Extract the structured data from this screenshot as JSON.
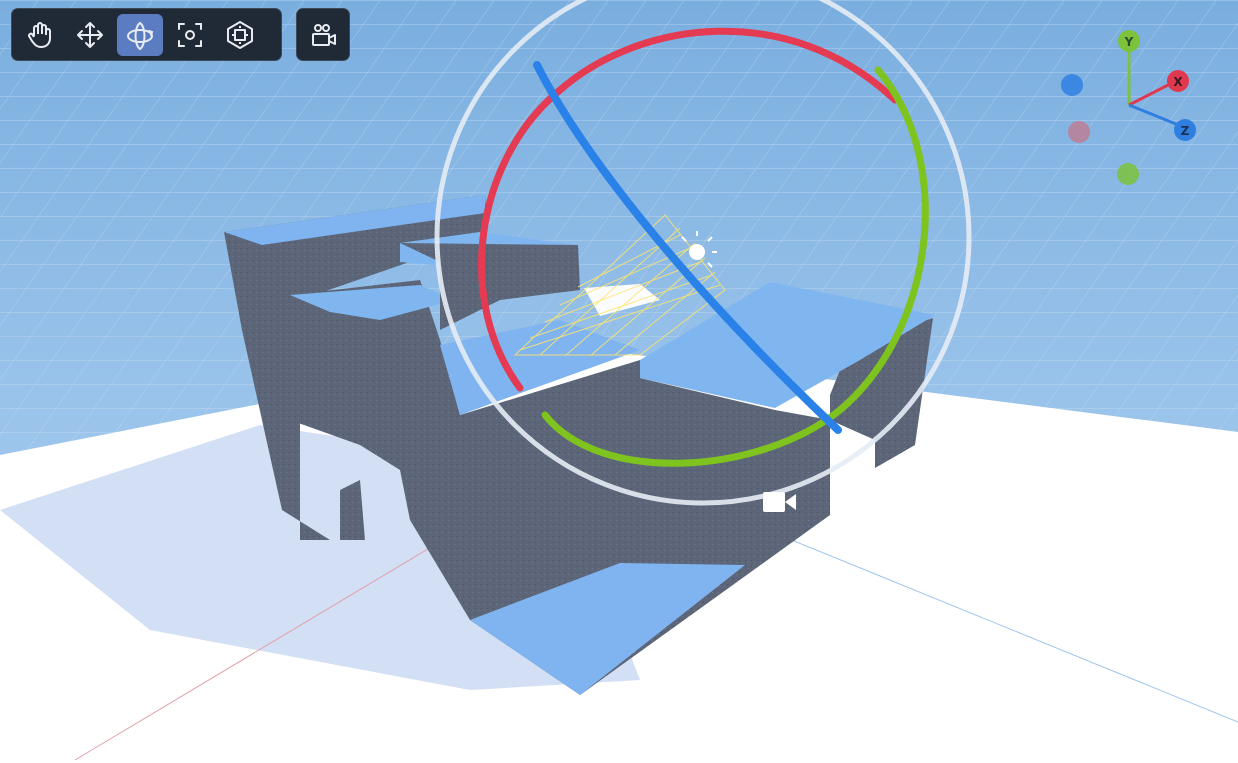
{
  "toolbar": {
    "tools": [
      {
        "name": "pan",
        "icon": "hand-icon",
        "active": false
      },
      {
        "name": "move",
        "icon": "move-arrows-icon",
        "active": false
      },
      {
        "name": "orbit",
        "icon": "orbit-icon",
        "active": true
      },
      {
        "name": "frame",
        "icon": "focus-frame-icon",
        "active": false
      },
      {
        "name": "fit",
        "icon": "fit-view-icon",
        "active": false
      }
    ],
    "camera_tool": {
      "name": "camera-view",
      "icon": "camera-person-icon"
    }
  },
  "gizmo": {
    "axes": [
      {
        "label": "Y",
        "color": "#7cc23a"
      },
      {
        "label": "X",
        "color": "#e0394f"
      },
      {
        "label": "Z",
        "color": "#2f7fe0"
      }
    ]
  },
  "colors": {
    "sky": "#84b3e2",
    "floor": "#ffffff",
    "model": "#5f6a7d",
    "model_top": "#7fb4f0",
    "ring_red": "#e43a52",
    "ring_green": "#7fc31f",
    "ring_blue": "#2a82e8",
    "ring_outer": "#e7edf6"
  }
}
